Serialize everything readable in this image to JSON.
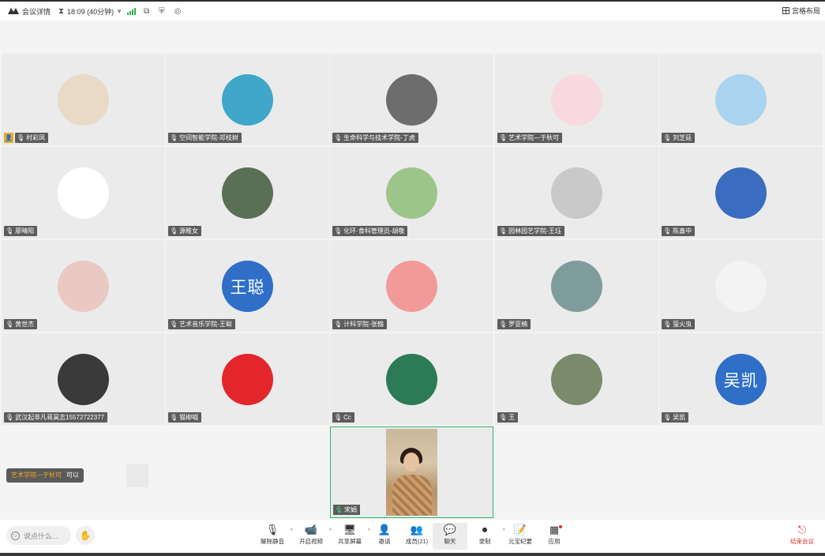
{
  "topbar": {
    "meeting_info": "会议详情",
    "time": "18:09 (40分钟)",
    "layout_label": "宫格布局"
  },
  "participants": [
    {
      "name": "村彩凤",
      "avatar_text": "",
      "host": true,
      "bg": "#e9d9c7"
    },
    {
      "name": "空间智能学院-邓枝树",
      "avatar_text": "",
      "bg": "#3fa7c9"
    },
    {
      "name": "生命科学与技术学院-丁虎",
      "avatar_text": "",
      "bg": "#6d6d6d"
    },
    {
      "name": "艺术学院—于秋可",
      "avatar_text": "",
      "bg": "#f7d9df"
    },
    {
      "name": "刘芝廷",
      "avatar_text": "",
      "bg": "#a9d3ee"
    },
    {
      "name": "廖晴阳",
      "avatar_text": "",
      "bg": "#ffffff"
    },
    {
      "name": "源稚女",
      "avatar_text": "",
      "bg": "#5b6f57"
    },
    {
      "name": "化环·食科管理员-胡敬",
      "avatar_text": "",
      "bg": "#9dc48a"
    },
    {
      "name": "园林园艺学院-王珏",
      "avatar_text": "",
      "bg": "#c9c9c9"
    },
    {
      "name": "陈鑫中",
      "avatar_text": "",
      "bg": "#3a6cbf"
    },
    {
      "name": "黄世杰",
      "avatar_text": "",
      "bg": "#eac8c4"
    },
    {
      "name": "艺术音乐学院-王聪",
      "avatar_text": "王聪",
      "bg": "#2f6fc7"
    },
    {
      "name": "计科学院-张翰",
      "avatar_text": "",
      "bg": "#f29a9a"
    },
    {
      "name": "罗亚楠",
      "avatar_text": "",
      "bg": "#7e9c9b"
    },
    {
      "name": "萤火虫",
      "avatar_text": "",
      "bg": "#f3f3f3"
    },
    {
      "name": "武汉起非凡蒋昊志15572722377",
      "avatar_text": "",
      "bg": "#3a3a3a"
    },
    {
      "name": "猫柳喵",
      "avatar_text": "",
      "bg": "#e3262b"
    },
    {
      "name": "Cc",
      "avatar_text": "",
      "bg": "#2d7a56"
    },
    {
      "name": "王",
      "avatar_text": "",
      "bg": "#7a8a6a"
    },
    {
      "name": "吴凯",
      "avatar_text": "吴凯",
      "bg": "#2f6fc7"
    }
  ],
  "speaker": {
    "name": "宋娟"
  },
  "chat_toast": {
    "sender": "艺术学院—于秋可",
    "message": "可以"
  },
  "toolbar": {
    "chat_placeholder": "说点什么...",
    "buttons": [
      {
        "label": "解除静音",
        "icon": "🎙"
      },
      {
        "label": "开启视频",
        "icon": "📹"
      },
      {
        "label": "共享屏幕",
        "icon": "🖥"
      },
      {
        "label": "邀请",
        "icon": "👤"
      },
      {
        "label": "成员(21)",
        "icon": "👥"
      },
      {
        "label": "聊天",
        "icon": "💬"
      },
      {
        "label": "录制",
        "icon": "⏺"
      },
      {
        "label": "元宝纪要",
        "icon": "📝"
      },
      {
        "label": "应用",
        "icon": "▦"
      }
    ],
    "end_label": "结束会议"
  },
  "colors": {
    "accent_green": "#2bb56a",
    "end_red": "#e0302c",
    "host_orange": "#f5a623"
  }
}
